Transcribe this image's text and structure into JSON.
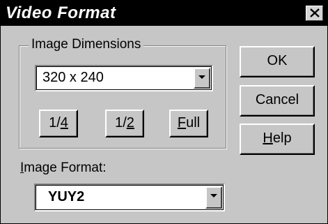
{
  "window": {
    "title": "Video Format"
  },
  "dimensions_group": {
    "label": "Image Dimensions",
    "size_select": {
      "value": "320 x 240"
    },
    "buttons": {
      "quarter": {
        "prefix": "1/",
        "mnemonic": "4"
      },
      "half": {
        "prefix": "1/",
        "mnemonic": "2"
      },
      "full": {
        "mnemonic": "F",
        "rest": "ull"
      }
    }
  },
  "format": {
    "label_mnemonic": "I",
    "label_rest": "mage Format:",
    "select": {
      "value": "YUY2"
    }
  },
  "actions": {
    "ok": "OK",
    "cancel": "Cancel",
    "help_mnemonic": "H",
    "help_rest": "elp"
  },
  "icons": {
    "close": "close-icon",
    "dropdown": "chevron-down-icon"
  }
}
